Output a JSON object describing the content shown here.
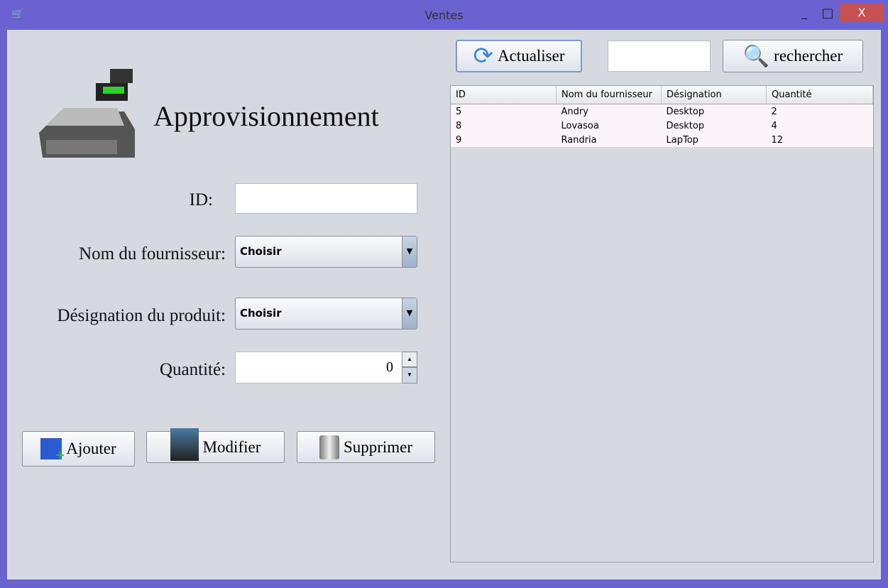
{
  "window": {
    "title": "Ventes",
    "minimize": "_",
    "maximize": "□",
    "close": "X"
  },
  "header": {
    "title": "Approvisionnement"
  },
  "form": {
    "id_label": "ID:",
    "id_value": "",
    "fournisseur_label": "Nom du fournisseur:",
    "fournisseur_value": "Choisir",
    "designation_label": "Désignation du produit:",
    "designation_value": "Choisir",
    "quantite_label": "Quantité:",
    "quantite_value": "0"
  },
  "buttons": {
    "ajouter": "Ajouter",
    "modifier": "Modifier",
    "supprimer": "Supprimer",
    "actualiser": "Actualiser",
    "rechercher": "rechercher"
  },
  "search": {
    "value": ""
  },
  "table": {
    "columns": [
      "ID",
      "Nom du fournisseur",
      "Désignation",
      "Quantité"
    ],
    "rows": [
      [
        "5",
        "Andry",
        "Desktop",
        "2"
      ],
      [
        "8",
        "Lovasoa",
        "Desktop",
        "4"
      ],
      [
        "9",
        "Randria",
        "LapTop",
        "12"
      ]
    ]
  }
}
